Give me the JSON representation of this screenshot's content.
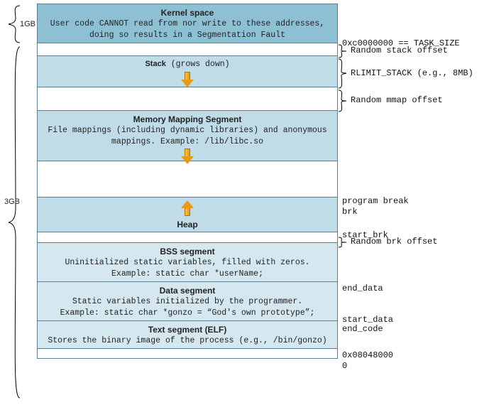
{
  "left": {
    "top_size": "1GB",
    "bottom_size": "3GB"
  },
  "kernel": {
    "title": "Kernel space",
    "desc": "User code CANNOT read from nor write to these addresses, doing so results in a Segmentation Fault"
  },
  "stack": {
    "title": "Stack",
    "suffix": " (grows down)",
    "offset_label": "Random stack offset",
    "limit_label": "RLIMIT_STACK (e.g., 8MB)",
    "mmap_offset_label": "Random mmap offset"
  },
  "mmap": {
    "title": "Memory Mapping Segment",
    "desc": "File mappings (including dynamic libraries) and anonymous mappings. Example: /lib/libc.so"
  },
  "heap": {
    "title": "Heap",
    "program_break": "program break",
    "brk": "brk",
    "start_brk": "start_brk",
    "brk_offset_label": "Random brk offset"
  },
  "bss": {
    "title": "BSS segment",
    "desc1": "Uninitialized static variables, filled with zeros.",
    "desc2": "Example: static char *userName;"
  },
  "data": {
    "title": "Data segment",
    "desc1": "Static variables initialized by the programmer.",
    "desc2": "Example: static char *gonzo = “God's own prototype”;",
    "end_label": "end_data",
    "start_label": "start_data"
  },
  "text": {
    "title": "Text segment (ELF)",
    "desc": "Stores the binary image of the process (e.g., /bin/gonzo)",
    "end_code": "end_code",
    "start_addr": "0x08048000"
  },
  "bottom": {
    "zero": "0"
  },
  "task_size": "0xc0000000 == TASK_SIZE"
}
